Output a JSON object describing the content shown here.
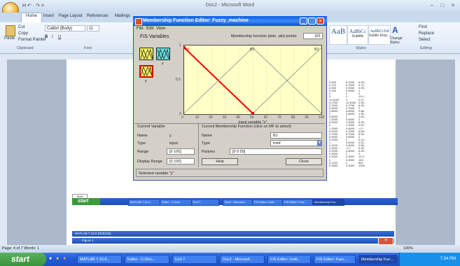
{
  "word": {
    "title": "Doc2 - Microsoft Word",
    "qat": " H ↶ · ↷ =",
    "controls": [
      "–",
      "□",
      "×"
    ],
    "tabs": [
      "Home",
      "Insert",
      "Page Layout",
      "References",
      "Mailings"
    ],
    "clipboard": {
      "paste": "Paste",
      "cut": "Cut",
      "copy": "Copy",
      "format_painter": "Format Painter",
      "group": "Clipboard"
    },
    "font": {
      "name": "Calibri (Body)",
      "size": "11",
      "group": "Font"
    },
    "styles": [
      {
        "sample": "AaB",
        "label": ""
      },
      {
        "sample": "AaBbCc",
        "label": "Subtitle"
      },
      {
        "sample": "AaBbCcDd",
        "label": "Subtle Emp..."
      }
    ],
    "change_styles": "Change Styles",
    "styles_group": "Styles",
    "editing": {
      "find": "Find",
      "replace": "Replace",
      "select": "Select",
      "group": "Editing"
    },
    "status": "Page: 4 of 7   Words: 1",
    "zoom": "100%",
    "data_col1": [
      "0.000",
      "0.710",
      "0.500",
      "0.000",
      "1",
      "3",
      "11.4000",
      "0.2750",
      "0.7500",
      "0.8000",
      "0.8000",
      "2",
      "0.8000",
      "1.3000",
      "0.3000",
      "2",
      "1.2000",
      "0.5000",
      "0.7000",
      "0.5000",
      "0.2000",
      "1",
      "0.1100",
      "1.3000",
      "0.2000",
      "0.3000",
      "0.3000",
      "3",
      "0.1200",
      "0.3000"
    ],
    "data_col2": [
      "8.7000",
      "0.7500",
      "0.5000",
      "0.5000",
      "2",
      "2",
      "1",
      "11.4000",
      "0.2750",
      "0.7500",
      "8.8000",
      "0.8000",
      "2",
      "0.8000",
      "4.3000",
      "1.3000",
      "0.8000",
      "0.2000",
      "8.7000",
      "0.6000",
      "2",
      "0.5000",
      "0.8000",
      "-0.7",
      "0.8000",
      "2",
      "0.3000",
      "0.3000",
      "2",
      "4.3000"
    ],
    "data_col3": [
      "8.35..",
      "0.72..",
      "0.05..",
      "2",
      "2",
      "11.4..",
      "0.27..",
      "0.55..",
      "8.35..",
      "2",
      "0.86..",
      "1.30..",
      "0.80..",
      "2",
      "8.35..",
      "0.51..",
      "-0.7..",
      "6.85..",
      "8.90..",
      "2",
      "0.22..",
      "0.51..",
      "0.55..",
      "6.30..",
      "6.95..",
      "2",
      "10.3..",
      "183",
      "861",
      "1009"
    ]
  },
  "inner": {
    "start_small": "Start",
    "start": "start",
    "tasks": [
      "MATLAB 7.10.0...",
      "Editor - C:\\Doc...",
      "Ex3-7",
      "Doc2 - Microsof...",
      "FIS Editor: Untit...",
      "FIS Editor: Fuzz...",
      "Membership Fun..."
    ],
    "matlab_strip": "MATLAB 7.10.0 (R2010a)",
    "figure_strip": "Figure 1"
  },
  "mf_editor": {
    "title": "Membership Function Editor: Fuzzy_machine",
    "menu": [
      "File",
      "Edit",
      "View"
    ],
    "fis_variables": "FIS Variables",
    "plot_label": "Membership function plots",
    "plot_points_label": "plot points:",
    "plot_points": "181",
    "var_in": "y",
    "var_out": "z",
    "mf_labels": [
      "B1",
      "B2",
      "B3"
    ],
    "yticks": [
      "1",
      "0.5",
      "0"
    ],
    "xticks": [
      "0",
      "10",
      "20",
      "30",
      "40",
      "50",
      "60",
      "70",
      "80",
      "90",
      "100"
    ],
    "axis_label": "input variable \"y\"",
    "current_variable": {
      "header": "Current Variable",
      "name_label": "Name",
      "name": "y",
      "type_label": "Type",
      "type": "input",
      "range_label": "Range",
      "range": "[0 100]",
      "display_label": "Display Range",
      "display": "[0 100]"
    },
    "current_mf": {
      "header": "Current Membership Function (click on MF to select)",
      "name_label": "Name",
      "name": "B1",
      "type_label": "Type",
      "type": "trimf",
      "params_label": "Params",
      "params": "[0 0 50]"
    },
    "help": "Help",
    "close": "Close",
    "selected": "Selected variable \"y\"",
    "controls": [
      "_",
      "□",
      "×"
    ]
  },
  "taskbar": {
    "start": "start",
    "quick": [
      "●",
      "●",
      "●"
    ],
    "tasks": [
      "MATLAB 7.10.0...",
      "Editor - C:\\Doc...",
      "Ex3-7",
      "Doc2 - Microsof...",
      "FIS Editor: Untit...",
      "FIS Editor: Fuzz...",
      "Membership Fun..."
    ],
    "clock": "7:34 PM"
  },
  "colors": {
    "selected_mf": "#ff0000",
    "mf_line": "#888888",
    "plot_bg": "#ffffc8",
    "taskbar": "#245edb"
  },
  "chart_data": {
    "type": "line",
    "xlabel": "input variable \"y\"",
    "xlim": [
      0,
      100
    ],
    "ylim": [
      0,
      1
    ],
    "series": [
      {
        "name": "B1",
        "x": [
          0,
          0,
          50
        ],
        "y": [
          1,
          1,
          0
        ]
      },
      {
        "name": "B2",
        "x": [
          0,
          50,
          100
        ],
        "y": [
          0,
          1,
          0
        ]
      },
      {
        "name": "B3",
        "x": [
          50,
          100,
          100
        ],
        "y": [
          0,
          1,
          1
        ]
      }
    ]
  }
}
